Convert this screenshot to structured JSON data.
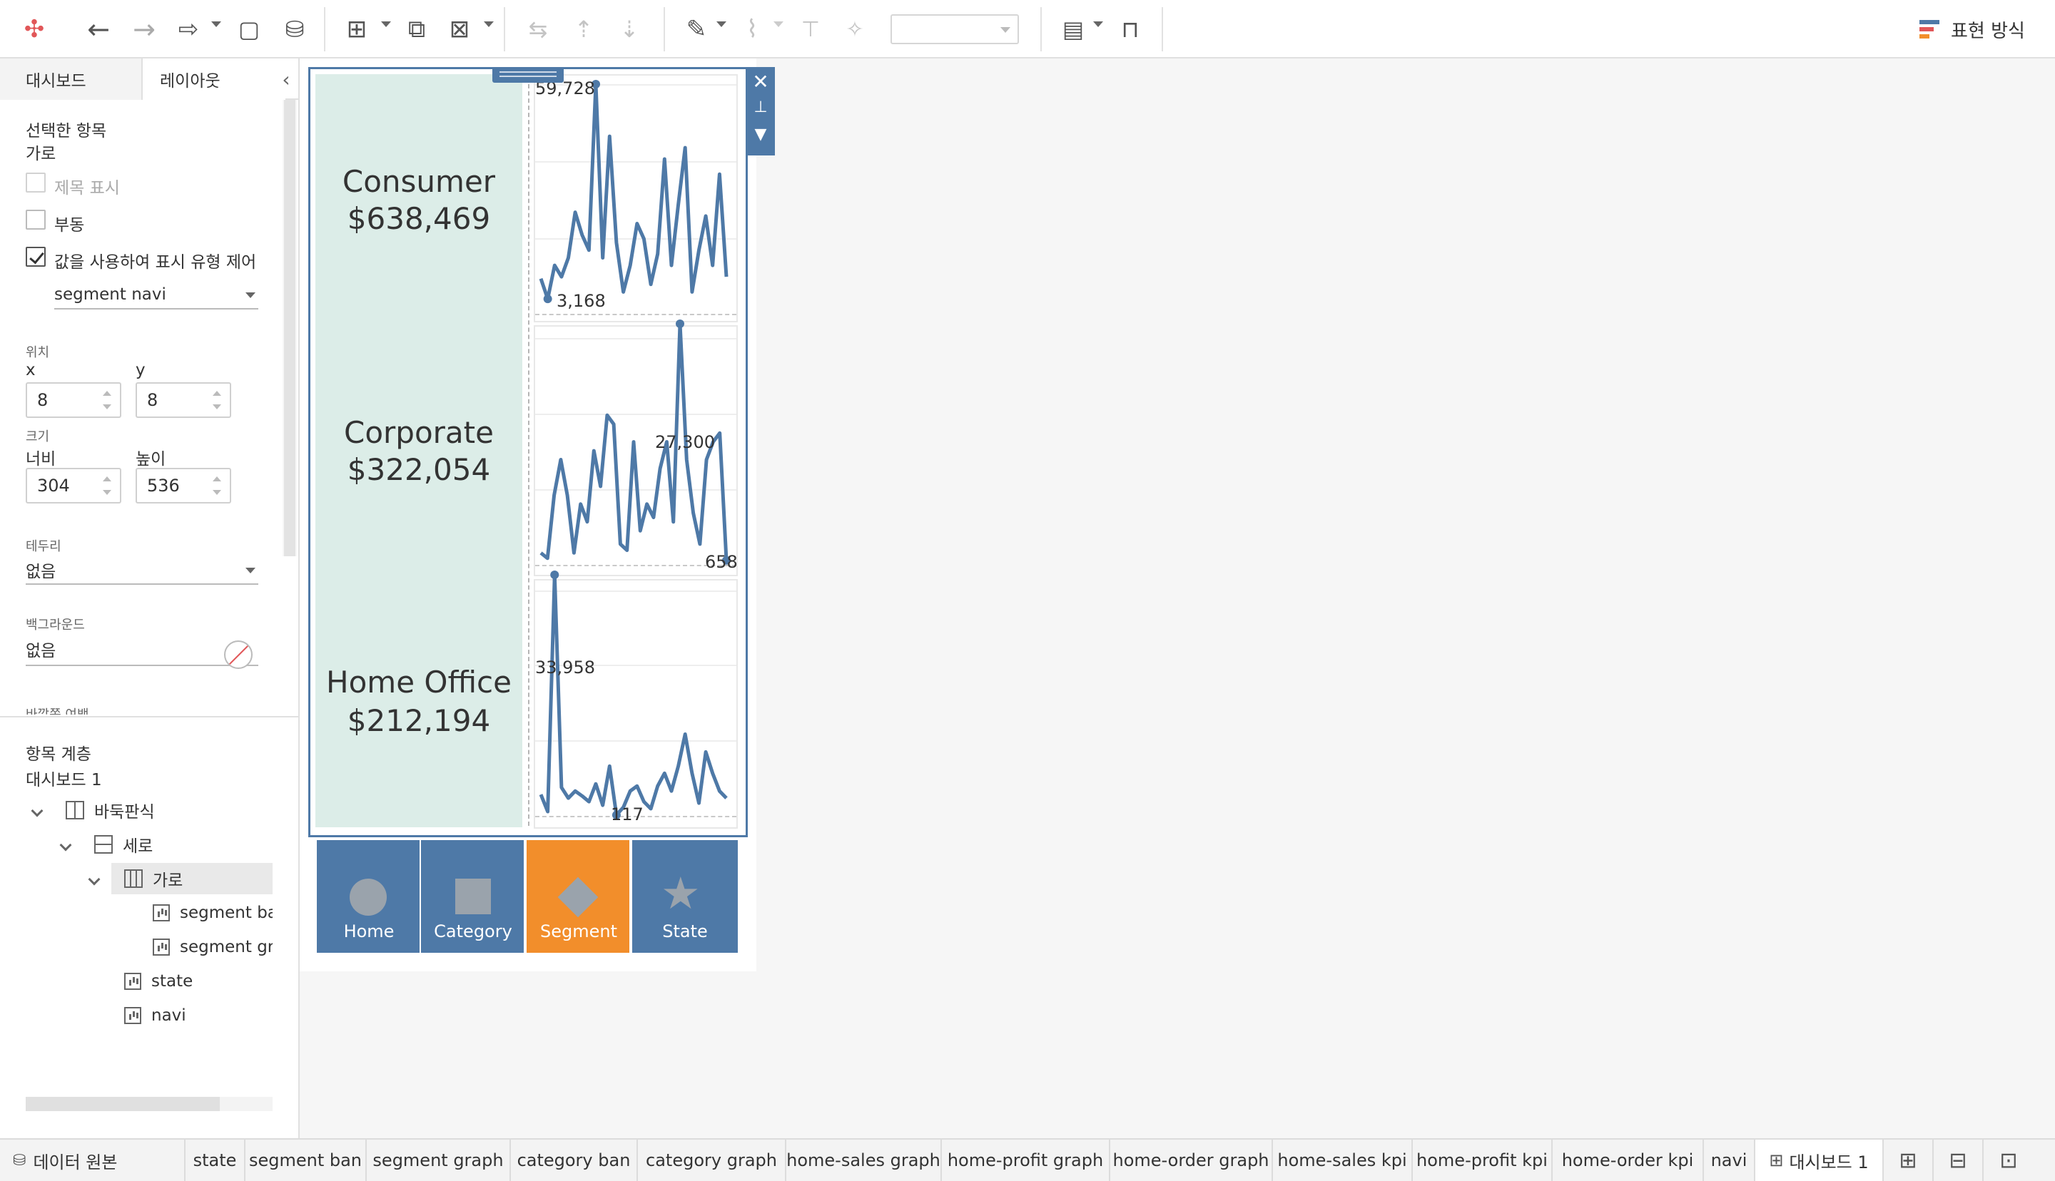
{
  "toolbar": {
    "show_me_label": "표현 방식",
    "icons": [
      "tableau-logo-icon",
      "undo-icon",
      "redo-icon",
      "replay-icon",
      "save-icon",
      "new-data-source-icon",
      "new-worksheet-icon",
      "duplicate-sheet-icon",
      "clear-sheet-icon",
      "swap-icon",
      "sort-ascending-icon",
      "sort-descending-icon",
      "highlight-icon",
      "group-icon",
      "label-icon",
      "pin-icon",
      "fit-dropdown",
      "show-cards-icon",
      "presentation-icon"
    ],
    "show_me_colors": [
      "#e15759",
      "#4e79a7",
      "#f28e2b"
    ]
  },
  "left_pane": {
    "tabs": {
      "dashboard": "대시보드",
      "layout": "레이아웃"
    },
    "selected_item_header": "선택한 항목",
    "selected_item_name": "가로",
    "show_title_label": "제목 표시",
    "show_title_checked": false,
    "floating_label": "부동",
    "floating_checked": false,
    "control_visibility_label": "값을 사용하여 표시 유형 제어",
    "control_visibility_checked": true,
    "visibility_field": "segment navi",
    "position_label": "위치",
    "x_label": "x",
    "x_value": "8",
    "y_label": "y",
    "y_value": "8",
    "size_label": "크기",
    "width_label": "너비",
    "width_value": "304",
    "height_label": "높이",
    "height_value": "536",
    "border_label": "테두리",
    "border_value": "없음",
    "background_label": "백그라운드",
    "background_value": "없음",
    "outer_padding_label": "바깥쪽 여백",
    "hierarchy_header": "항목 계층",
    "hierarchy_root": "대시보드 1",
    "tree": [
      {
        "label": "바둑판식",
        "type": "tile",
        "level": 0,
        "expandable": true
      },
      {
        "label": "세로",
        "type": "vert",
        "level": 1,
        "expandable": true
      },
      {
        "label": "가로",
        "type": "horiz",
        "level": 2,
        "expandable": true,
        "selected": true
      },
      {
        "label": "segment ban",
        "type": "sheet",
        "level": 3
      },
      {
        "label": "segment graph",
        "type": "sheet",
        "level": 3
      },
      {
        "label": "state",
        "type": "sheet",
        "level": 2
      },
      {
        "label": "navi",
        "type": "sheet",
        "level": 2
      }
    ]
  },
  "dashboard": {
    "colors": {
      "accent": "#4e79a7",
      "ban_bg": "#dcede8",
      "active_nav": "#f28e2b",
      "line": "#4e79a7"
    },
    "segments": [
      {
        "name": "Consumer",
        "value": "$638,469",
        "max_label": "59,728",
        "min_label": "3,168"
      },
      {
        "name": "Corporate",
        "value": "$322,054",
        "max_label": "27,300",
        "min_label": "658"
      },
      {
        "name": "Home Office",
        "value": "$212,194",
        "max_label": "33,958",
        "min_label": "117"
      }
    ],
    "navi": [
      {
        "label": "Home",
        "shape": "circle",
        "active": false
      },
      {
        "label": "Category",
        "shape": "square",
        "active": false
      },
      {
        "label": "Segment",
        "shape": "diamond",
        "active": true
      },
      {
        "label": "State",
        "shape": "star",
        "active": false
      }
    ],
    "controls": {
      "close": "✕",
      "pin": "📌",
      "more": "▾"
    }
  },
  "chart_data": [
    {
      "type": "line",
      "title": "",
      "series": [
        {
          "values": [
            8500,
            3168,
            12000,
            9000,
            14000,
            26000,
            20000,
            16000,
            59728,
            14000,
            46000,
            18000,
            5000,
            12000,
            23000,
            19000,
            7000,
            15000,
            40000,
            12000,
            28000,
            43000,
            5000,
            16000,
            25000,
            12000,
            36000,
            9000
          ]
        }
      ],
      "max": 59728,
      "min": 3168
    },
    {
      "type": "line",
      "title": "",
      "series": [
        {
          "values": [
            1500,
            900,
            8000,
            12000,
            8000,
            1500,
            7000,
            5000,
            13000,
            9000,
            17000,
            16000,
            2500,
            1800,
            14000,
            4000,
            7000,
            5500,
            11000,
            14000,
            5000,
            27300,
            12000,
            6000,
            2500,
            12000,
            14000,
            15000,
            658
          ]
        }
      ],
      "max": 27300,
      "min": 658
    },
    {
      "type": "line",
      "title": "",
      "series": [
        {
          "values": [
            3000,
            600,
            33958,
            4000,
            2500,
            3500,
            2800,
            2000,
            4500,
            1500,
            7000,
            117,
            1200,
            3500,
            4200,
            2000,
            1000,
            4200,
            6000,
            3500,
            7000,
            11500,
            6000,
            1800,
            9000,
            6000,
            3500,
            2500
          ]
        }
      ],
      "max": 33958,
      "min": 117
    }
  ],
  "sheet_tabs": {
    "data_source": "데이터 원본",
    "sheets": [
      "state",
      "segment ban",
      "segment graph",
      "category ban",
      "category graph",
      "home-sales graph",
      "home-profit graph",
      "home-order graph",
      "home-sales kpi",
      "home-profit kpi",
      "home-order kpi",
      "navi"
    ],
    "active_dashboard": "대시보드 1"
  }
}
